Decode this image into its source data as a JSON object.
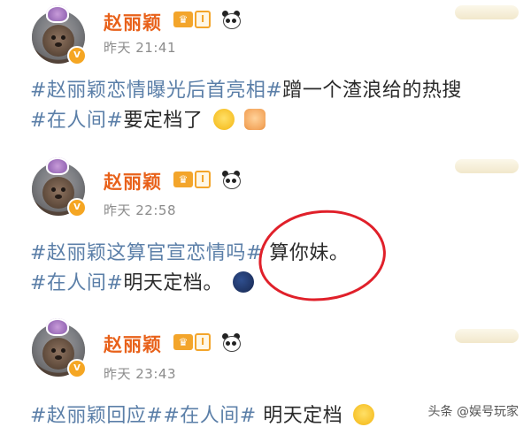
{
  "posts": [
    {
      "author": "赵丽颖",
      "level": "I",
      "time": "昨天 21:41",
      "lines": [
        [
          {
            "t": "#赵丽颖恋情曝光后首亮相#",
            "tag": true
          },
          {
            "t": "蹭一个渣浪给的热搜",
            "tag": false
          }
        ],
        [
          {
            "t": "#在人间#",
            "tag": true
          },
          {
            "t": "要定档了",
            "tag": false
          }
        ]
      ],
      "emojis": [
        "laugh",
        "shock"
      ]
    },
    {
      "author": "赵丽颖",
      "level": "I",
      "time": "昨天 22:58",
      "lines": [
        [
          {
            "t": "#赵丽颖这算官宣恋情吗#",
            "tag": true
          },
          {
            "t": " 算你妹。",
            "tag": false
          }
        ],
        [
          {
            "t": "#在人间#",
            "tag": true
          },
          {
            "t": "明天定档。",
            "tag": false
          }
        ]
      ],
      "emojis": [
        "moon"
      ]
    },
    {
      "author": "赵丽颖",
      "level": "I",
      "time": "昨天 23:43",
      "lines": [
        [
          {
            "t": "#赵丽颖回应##在人间#",
            "tag": true
          },
          {
            "t": " 明天定档",
            "tag": false
          }
        ]
      ],
      "emojis": [
        "yawn"
      ]
    }
  ],
  "watermark": "头条 @娱号玩家",
  "colors": {
    "name": "#e8611a",
    "hashtag": "#5b7fa8",
    "time": "#8c8c8c",
    "annotation_circle": "#e0202a"
  }
}
